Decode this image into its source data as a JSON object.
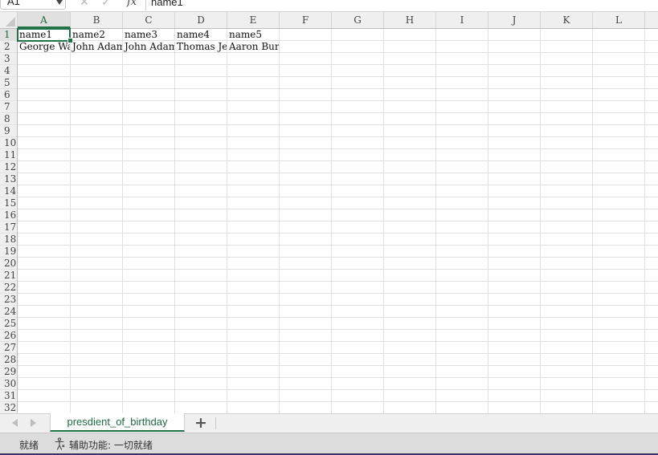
{
  "formula_bar": {
    "name_box": "A1",
    "cancel_icon": "✕",
    "confirm_icon": "✓",
    "fx_label": "fx",
    "value": "name1"
  },
  "columns": [
    "A",
    "B",
    "C",
    "D",
    "E",
    "F",
    "G",
    "H",
    "I",
    "J",
    "K",
    "L"
  ],
  "rows": [
    "1",
    "2",
    "3",
    "4",
    "5",
    "6",
    "7",
    "8",
    "9",
    "10",
    "11",
    "12",
    "13",
    "14",
    "15",
    "16",
    "17",
    "18",
    "19",
    "20",
    "21",
    "22",
    "23",
    "24",
    "25",
    "26",
    "27",
    "28",
    "29",
    "30",
    "31",
    "32"
  ],
  "cells": {
    "A1": "name1",
    "B1": "name2",
    "C1": "name3",
    "D1": "name4",
    "E1": "name5",
    "A2": "George Washington",
    "B2": "John Adams",
    "C2": "John Adams",
    "D2": "Thomas Jefferson",
    "E2": "Aaron Burr"
  },
  "selected_cell": "A1",
  "sheet_tabs": [
    {
      "label": "presdient_of_birthday",
      "active": true
    }
  ],
  "add_sheet_label": "+",
  "status_bar": {
    "ready": "就绪",
    "accessibility": "辅助功能: 一切就绪"
  },
  "colors": {
    "accent": "#217346",
    "header_bg": "#efefef",
    "status_bg": "#dcdcdc"
  }
}
